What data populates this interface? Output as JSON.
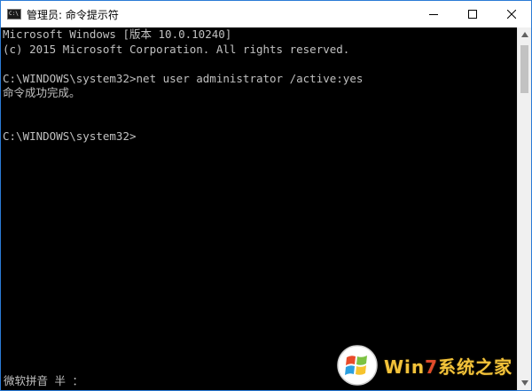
{
  "window": {
    "title": "管理员: 命令提示符",
    "app_icon_glyph": "C:\\",
    "controls": {
      "minimize_icon": "minimize-icon",
      "maximize_icon": "maximize-icon",
      "close_icon": "close-icon"
    }
  },
  "console": {
    "lines": [
      "Microsoft Windows [版本 10.0.10240]",
      "(c) 2015 Microsoft Corporation. All rights reserved.",
      "",
      "C:\\WINDOWS\\system32>net user administrator /active:yes",
      "命令成功完成。",
      "",
      "",
      "C:\\WINDOWS\\system32>"
    ]
  },
  "ime": {
    "status": "微软拼音 半 ："
  },
  "watermark": {
    "text_prefix": "Win",
    "text_seven": "7",
    "text_suffix": "系统之家",
    "logo_icon": "windows-logo-icon"
  },
  "colors": {
    "console_bg": "#000000",
    "console_text": "#c0c0c0",
    "titlebar_bg": "#ffffff",
    "window_border": "#2b7bd6",
    "watermark_gold": "#f2c23a",
    "watermark_red": "#e14b2b"
  }
}
